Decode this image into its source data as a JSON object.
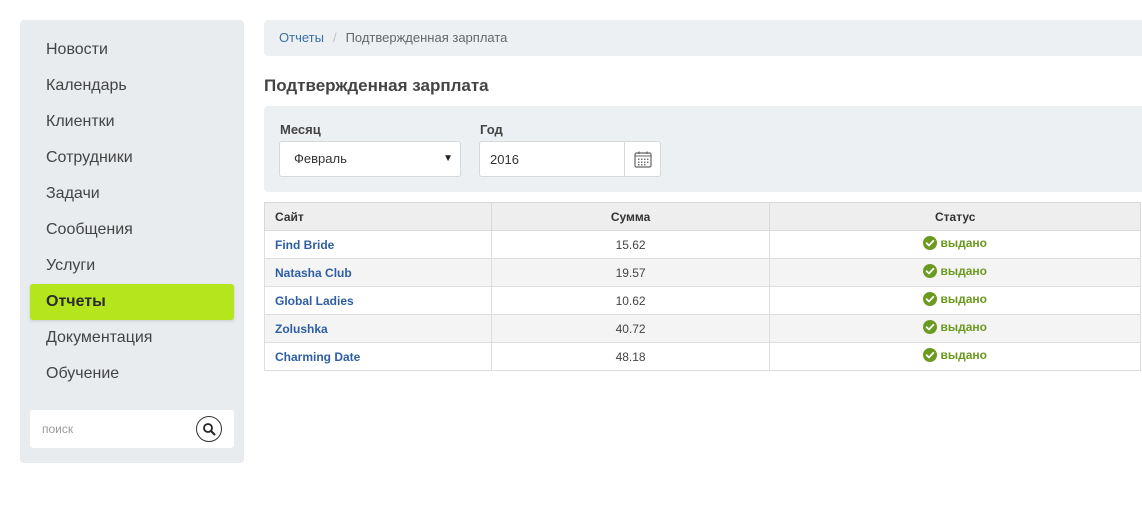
{
  "sidebar": {
    "items": [
      {
        "label": "Новости"
      },
      {
        "label": "Календарь"
      },
      {
        "label": "Клиентки"
      },
      {
        "label": "Сотрудники"
      },
      {
        "label": "Задачи"
      },
      {
        "label": "Сообщения"
      },
      {
        "label": "Услуги"
      },
      {
        "label": "Отчеты"
      },
      {
        "label": "Документация"
      },
      {
        "label": "Обучение"
      }
    ],
    "active_label": "Отчеты",
    "search": {
      "placeholder": "поиск",
      "icon": "search-icon"
    }
  },
  "breadcrumb": {
    "link": "Отчеты",
    "separator": "/",
    "current": "Подтвержденная зарплата"
  },
  "page": {
    "title": "Подтвержденная зарплата"
  },
  "filters": {
    "month": {
      "label": "Месяц",
      "value": "Февраль"
    },
    "year": {
      "label": "Год",
      "value": "2016",
      "icon": "calendar-icon"
    }
  },
  "table": {
    "headers": [
      "Сайт",
      "Сумма",
      "Статус"
    ],
    "rows": [
      {
        "site": "Find Bride",
        "amount": "15.62",
        "status": "выдано"
      },
      {
        "site": "Natasha Club",
        "amount": "19.57",
        "status": "выдано"
      },
      {
        "site": "Global Ladies",
        "amount": "10.62",
        "status": "выдано"
      },
      {
        "site": "Zolushka",
        "amount": "40.72",
        "status": "выдано"
      },
      {
        "site": "Charming Date",
        "amount": "48.18",
        "status": "выдано"
      }
    ]
  },
  "colors": {
    "active_nav": "#b5e61d",
    "link": "#2e5fa3",
    "status_ok": "#6a9a1f"
  }
}
